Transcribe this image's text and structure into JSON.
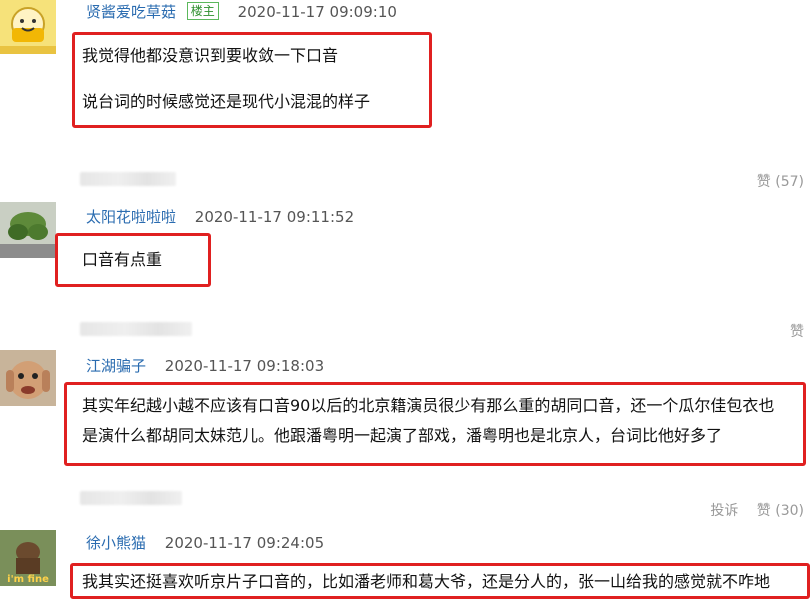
{
  "comments": [
    {
      "username": "贤酱爱吃草菇",
      "badge": "楼主",
      "time": "2020-11-17 09:09:10",
      "lines": [
        "我觉得他都没意识到要收敛一下口音",
        "说台词的时候感觉还是现代小混混的样子"
      ],
      "like_label": "赞 (57)"
    },
    {
      "username": "太阳花啦啦啦",
      "time": "2020-11-17 09:11:52",
      "lines": [
        "口音有点重"
      ],
      "like_label": "赞"
    },
    {
      "username": "江湖骗子",
      "time": "2020-11-17 09:18:03",
      "lines": [
        "其实年纪越小越不应该有口音90以后的北京籍演员很少有那么重的胡同口音，还一个瓜尔佳包衣也",
        "是演什么都胡同太妹范儿。他跟潘粤明一起演了部戏，潘粤明也是北京人，台词比他好多了"
      ],
      "report_label": "投诉",
      "like_label": "赞 (30)"
    },
    {
      "username": "徐小熊猫",
      "time": "2020-11-17 09:24:05",
      "lines": [
        "我其实还挺喜欢听京片子口音的，比如潘老师和葛大爷，还是分人的，张一山给我的感觉就不咋地"
      ],
      "avatar_text": "i'm fine"
    }
  ]
}
